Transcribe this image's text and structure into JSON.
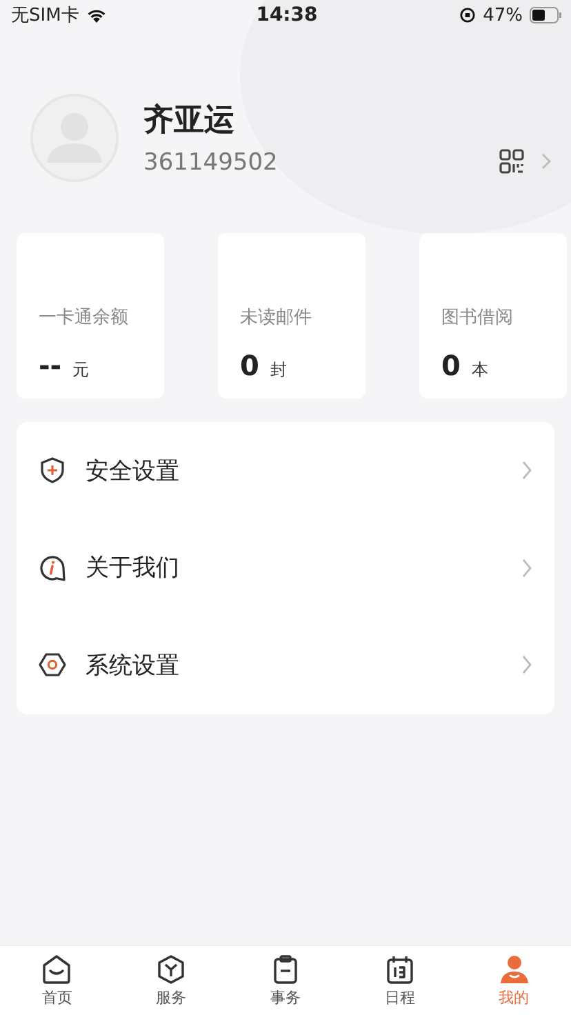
{
  "status_bar": {
    "carrier": "无SIM卡",
    "time": "14:38",
    "battery": "47%"
  },
  "profile": {
    "name": "齐亚运",
    "id": "361149502"
  },
  "stats": [
    {
      "label": "一卡通余额",
      "value": "--",
      "unit": "元"
    },
    {
      "label": "未读邮件",
      "value": "0",
      "unit": "封"
    },
    {
      "label": "图书借阅",
      "value": "0",
      "unit": "本"
    }
  ],
  "menu": [
    {
      "kind": "security",
      "label": "安全设置"
    },
    {
      "kind": "about",
      "label": "关于我们"
    },
    {
      "kind": "settings",
      "label": "系统设置"
    }
  ],
  "tabs": [
    {
      "kind": "home",
      "label": "首页",
      "selected": false
    },
    {
      "kind": "service",
      "label": "服务",
      "selected": false
    },
    {
      "kind": "affairs",
      "label": "事务",
      "selected": false
    },
    {
      "kind": "schedule",
      "label": "日程",
      "selected": false
    },
    {
      "kind": "mine",
      "label": "我的",
      "selected": true
    }
  ]
}
